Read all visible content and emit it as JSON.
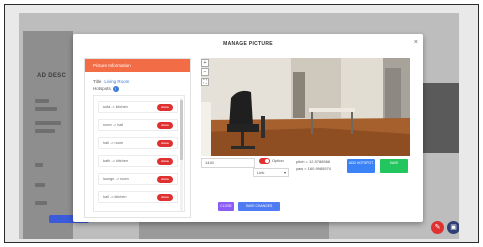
{
  "background": {
    "page_title": "AD DESC",
    "fab_edit_icon": "pencil-icon",
    "fab_save_icon": "save-icon"
  },
  "modal": {
    "title": "MANAGE PICTURE",
    "close_glyph": "×"
  },
  "panel": {
    "header": "Picture Information",
    "title_label": "Title",
    "title_value": "Living Room",
    "hotspots_label": "Hotspots",
    "info_glyph": "i",
    "items": [
      {
        "label": "sofa -> kitchen",
        "delete_label": "delete"
      },
      {
        "label": "room -> hall",
        "delete_label": "delete"
      },
      {
        "label": "hall -> room",
        "delete_label": "delete"
      },
      {
        "label": "bath -> kitchen",
        "delete_label": "delete"
      },
      {
        "label": "lounge -> room",
        "delete_label": "delete"
      },
      {
        "label": "hall -> kitchen",
        "delete_label": "delete"
      }
    ]
  },
  "viewer": {
    "zoom_in": "+",
    "zoom_out": "−",
    "fullscreen": "⛶",
    "coord_value": "1440",
    "toggle_label": "Option",
    "select_value": "Link",
    "select_arrow": "▾",
    "pitch": "pitch = 12.5788566",
    "yaw": "yaw = 160.9985974",
    "add_button": "ADD HOTSPOT",
    "save_button": "SAVE"
  },
  "footer": {
    "close_button": "CLOSE",
    "save_changes_button": "SAVE CHANGES"
  }
}
